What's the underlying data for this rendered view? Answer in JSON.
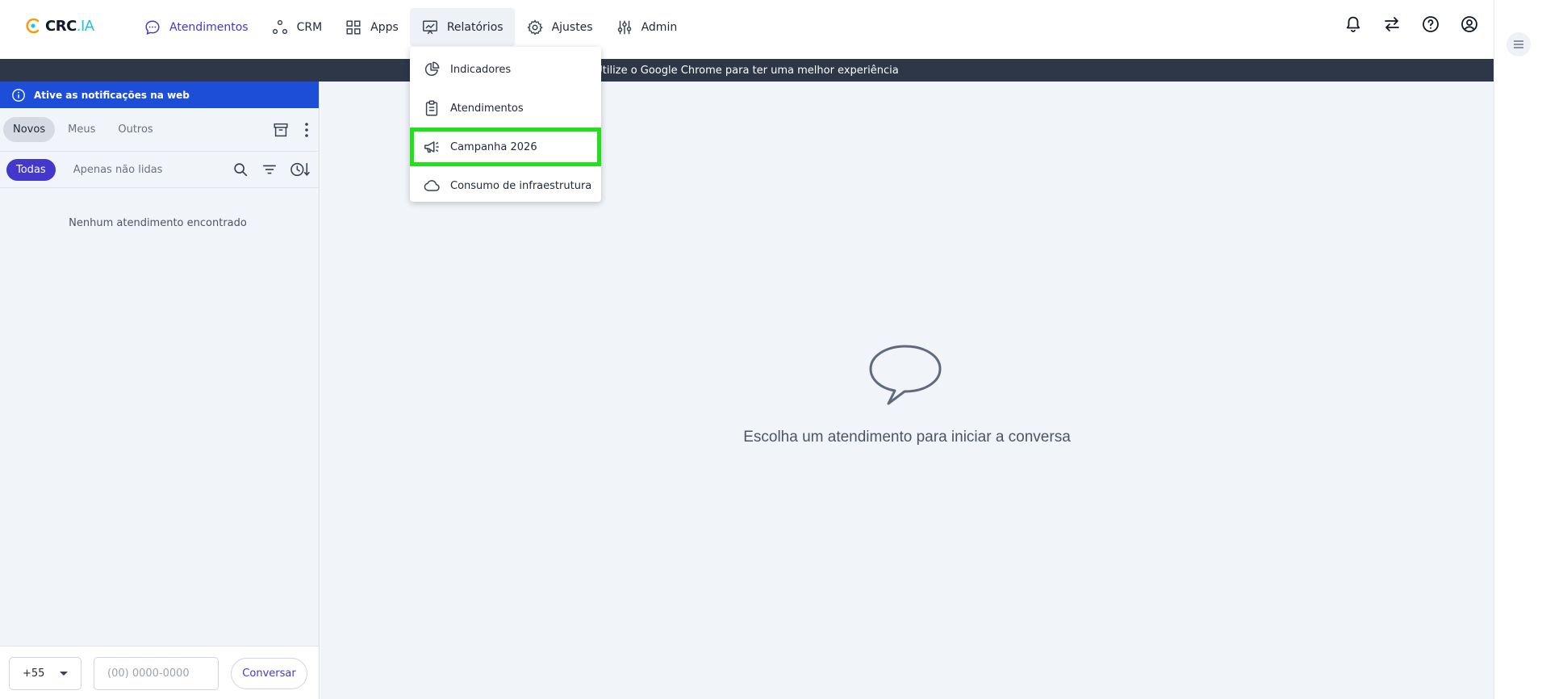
{
  "brand": {
    "name": "CRC",
    "suffix": ".IA",
    "accent": "#22c1dc"
  },
  "nav": {
    "items": [
      {
        "label": "Atendimentos",
        "icon": "chat-bubble-icon"
      },
      {
        "label": "CRM",
        "icon": "nodes-icon"
      },
      {
        "label": "Apps",
        "icon": "grid-icon"
      },
      {
        "label": "Relatórios",
        "icon": "chart-presentation-icon"
      },
      {
        "label": "Ajustes",
        "icon": "gear-icon"
      },
      {
        "label": "Admin",
        "icon": "sliders-icon"
      }
    ],
    "active_color": "#4338ca"
  },
  "reports_menu": {
    "items": [
      {
        "label": "Indicadores",
        "icon": "pie-chart-icon"
      },
      {
        "label": "Atendimentos",
        "icon": "clipboard-icon"
      },
      {
        "label": "Campanha 2026",
        "icon": "megaphone-icon"
      },
      {
        "label": "Consumo de infraestrutura",
        "icon": "cloud-icon"
      }
    ],
    "highlight_color": "#22e01c"
  },
  "banner": {
    "text": "Utilize o Google Chrome para ter uma melhor experiência"
  },
  "sidebar": {
    "notice": "Ative as notificações na web",
    "tabs": [
      "Novos",
      "Meus",
      "Outros"
    ],
    "filters": {
      "all": "Todas",
      "unread": "Apenas não lidas"
    },
    "empty_text": "Nenhum atendimento encontrado",
    "footer": {
      "country_code": "+55",
      "phone_placeholder": "(00) 0000-0000",
      "button": "Conversar"
    }
  },
  "main": {
    "empty_text": "Escolha um atendimento para iniciar a conversa"
  }
}
